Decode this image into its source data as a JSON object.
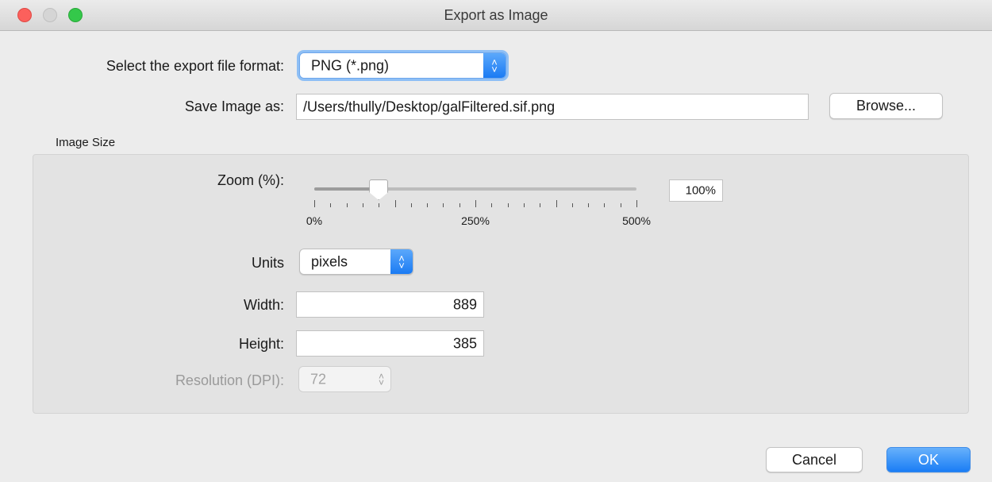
{
  "window": {
    "title": "Export as Image"
  },
  "format": {
    "label": "Select the export file format:",
    "selected": "PNG (*.png)"
  },
  "save": {
    "label": "Save Image as:",
    "path": "/Users/thully/Desktop/galFiltered.sif.png",
    "browse_label": "Browse..."
  },
  "image_size": {
    "section_label": "Image Size",
    "zoom": {
      "label": "Zoom (%):",
      "value_text": "100%",
      "value": 100,
      "min": 0,
      "max": 500,
      "tick_labels": [
        "0%",
        "250%",
        "500%"
      ]
    },
    "units": {
      "label": "Units",
      "selected": "pixels"
    },
    "width": {
      "label": "Width:",
      "value": "889"
    },
    "height": {
      "label": "Height:",
      "value": "385"
    },
    "resolution": {
      "label": "Resolution (DPI):",
      "value": "72",
      "enabled": false
    }
  },
  "actions": {
    "cancel_label": "Cancel",
    "ok_label": "OK"
  },
  "colors": {
    "accent": "#1b7bf3",
    "close": "#fc605c",
    "maximize": "#34c84a"
  }
}
